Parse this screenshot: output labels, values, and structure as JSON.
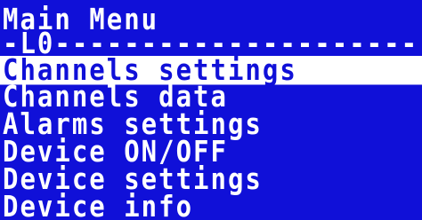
{
  "screen": {
    "title": "Main Menu",
    "divider": "-L0-------------------------"
  },
  "menu": {
    "selected_index": 0,
    "items": [
      {
        "label": "Channels settings"
      },
      {
        "label": "Channels data"
      },
      {
        "label": "Alarms settings"
      },
      {
        "label": "Device ON/OFF"
      },
      {
        "label": "Device settings"
      },
      {
        "label": "Device info"
      }
    ]
  },
  "colors": {
    "background": "#1010d8",
    "text": "#ffffff",
    "highlight_bg": "#ffffff",
    "highlight_text": "#1010d8"
  }
}
